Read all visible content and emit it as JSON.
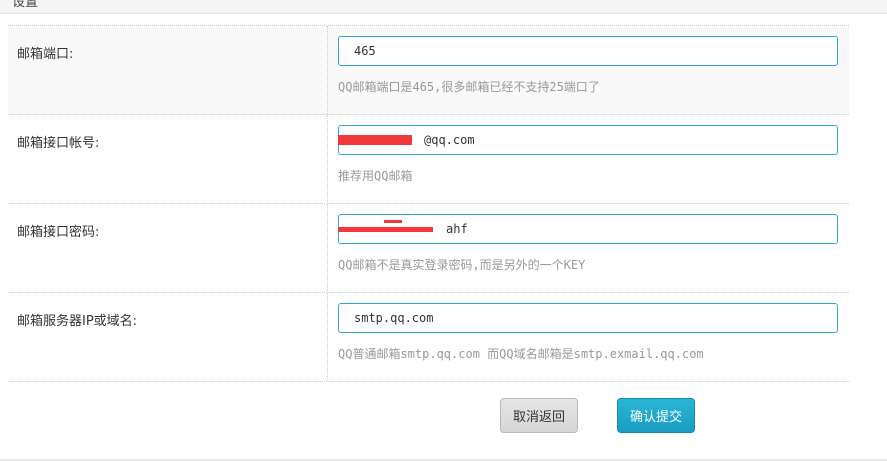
{
  "section": {
    "title": "设置"
  },
  "form": {
    "rows": [
      {
        "label": "邮箱端口:",
        "value": "465",
        "hint": "QQ邮箱端口是465,很多邮箱已经不支持25端口了"
      },
      {
        "label": "邮箱接口帐号:",
        "value": "@qq.com",
        "hint": "推荐用QQ邮箱"
      },
      {
        "label": "邮箱接口密码:",
        "value": "ahf",
        "hint": "QQ邮箱不是真实登录密码,而是另外的一个KEY"
      },
      {
        "label": "邮箱服务器IP或域名:",
        "value": "smtp.qq.com",
        "hint": "QQ普通邮箱smtp.qq.com 而QQ域名邮箱是smtp.exmail.qq.com"
      }
    ]
  },
  "actions": {
    "cancel_label": "取消返回",
    "submit_label": "确认提交"
  },
  "colors": {
    "input_border": "#2fa4d7",
    "submit_bg": "#1a9cc2",
    "redaction": "#f2383a",
    "hint_text": "#999999"
  }
}
